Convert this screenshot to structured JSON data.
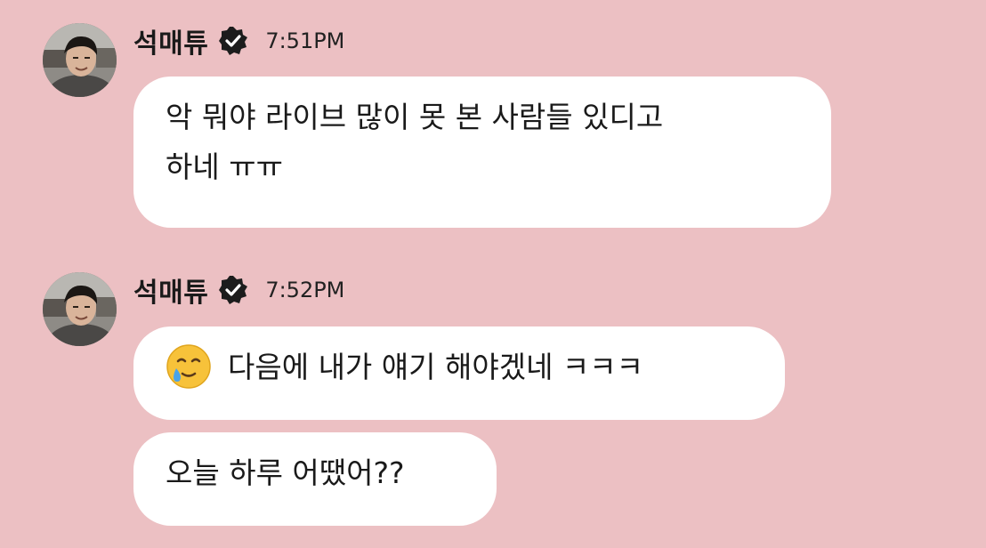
{
  "conversation": {
    "messages": [
      {
        "sender": "석매튜",
        "verified_icon": "verified-badge-icon",
        "time": "7:51PM",
        "bubbles": [
          {
            "lines": [
              "악 뭐야 라이브 많이 못 본 사람들 있디고",
              "하네 ㅠㅠ"
            ]
          }
        ]
      },
      {
        "sender": "석매튜",
        "verified_icon": "verified-badge-icon",
        "time": "7:52PM",
        "bubbles": [
          {
            "emoji": "smiling-face-with-tear-icon",
            "text": "다음에 내가 얘기 해야겠네 ㅋㅋㅋ"
          },
          {
            "text": "오늘 하루 어땠어??"
          }
        ]
      }
    ]
  },
  "colors": {
    "background": "#ecc0c3",
    "bubble": "#ffffff",
    "text": "#1a1a1a"
  }
}
